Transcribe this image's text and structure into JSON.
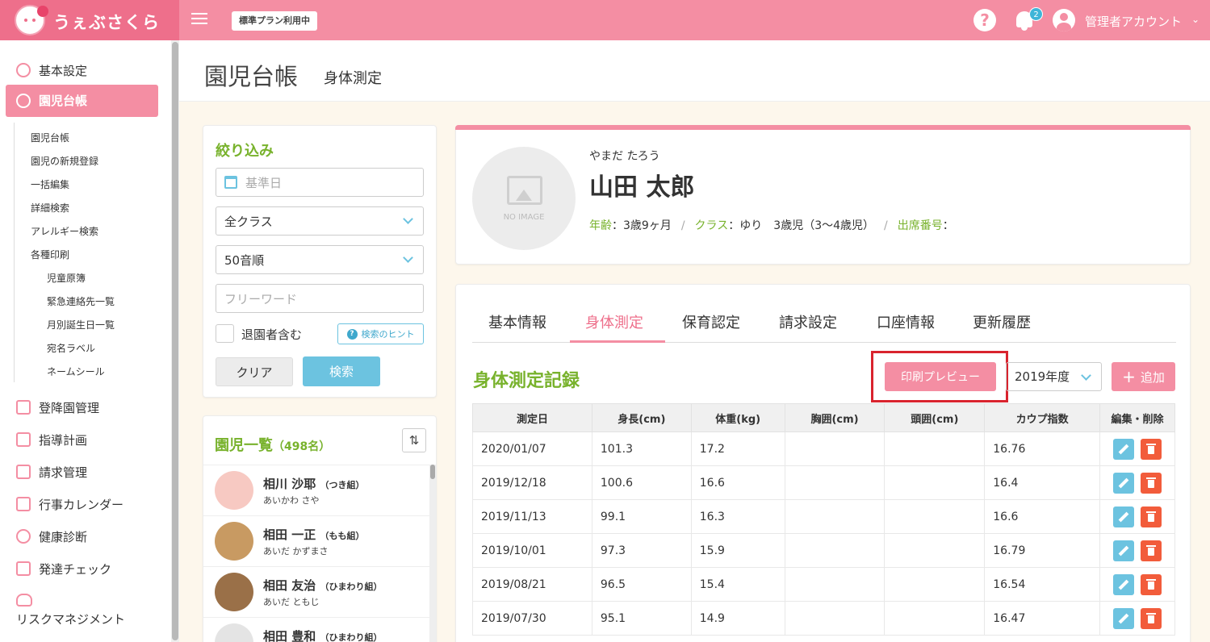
{
  "header": {
    "app_name": "うぇぶさくら",
    "plan_badge": "標準プラン利用中",
    "help_glyph": "?",
    "notification_count": "2",
    "user_name": "管理者アカウント",
    "user_chevron": "⌄"
  },
  "sidebar": {
    "items": [
      {
        "label": "基本設定",
        "icon": "gear-icon"
      },
      {
        "label": "園児台帳",
        "icon": "child-face-icon",
        "active": true
      },
      {
        "label": "登降園管理",
        "icon": "school-icon"
      },
      {
        "label": "指導計画",
        "icon": "notebook-icon"
      },
      {
        "label": "請求管理",
        "icon": "calculator-icon"
      },
      {
        "label": "行事カレンダー",
        "icon": "calendar-icon"
      },
      {
        "label": "健康診断",
        "icon": "stethoscope-icon"
      },
      {
        "label": "発達チェック",
        "icon": "checklist-icon"
      },
      {
        "label": "リスクマネジメント",
        "icon": "hands-heart-icon"
      }
    ],
    "subitems": [
      "園児台帳",
      "園児の新規登録",
      "一括編集",
      "詳細検索",
      "アレルギー検索",
      "各種印刷"
    ],
    "print_subitems": [
      "児童原簿",
      "緊急連絡先一覧",
      "月別誕生日一覧",
      "宛名ラベル",
      "ネームシール"
    ]
  },
  "page": {
    "title": "園児台帳",
    "subtitle": "身体測定"
  },
  "filter": {
    "title": "絞り込み",
    "date_placeholder": "基準日",
    "class_value": "全クラス",
    "order_value": "50音順",
    "keyword_placeholder": "フリーワード",
    "include_withdrawn_label": "退園者含む",
    "hint_label": "検索のヒント",
    "clear_label": "クリア",
    "search_label": "検索"
  },
  "child_list": {
    "title": "園児一覧",
    "count": "（498名）",
    "sort_glyph": "⇅",
    "children": [
      {
        "name": "相川 沙耶",
        "class": "（つき組）",
        "kana": "あいかわ さや"
      },
      {
        "name": "相田 一正",
        "class": "（もも組）",
        "kana": "あいだ かずまさ"
      },
      {
        "name": "相田 友治",
        "class": "（ひまわり組）",
        "kana": "あいだ ともじ"
      },
      {
        "name": "相田 豊和",
        "class": "（ひまわり組）",
        "kana": ""
      }
    ]
  },
  "profile": {
    "no_image_text": "NO IMAGE",
    "kana": "やまだ たろう",
    "name": "山田 太郎",
    "age_label": "年齢",
    "age_value": "：3歳9ヶ月",
    "class_label": "クラス",
    "class_value": "：ゆり　3歳児（3〜4歳児）",
    "seat_label": "出席番号",
    "seat_value": "：",
    "separator": "/"
  },
  "tabs": [
    {
      "label": "基本情報"
    },
    {
      "label": "身体測定",
      "active": true
    },
    {
      "label": "保育認定"
    },
    {
      "label": "請求設定"
    },
    {
      "label": "口座情報"
    },
    {
      "label": "更新履歴"
    }
  ],
  "records": {
    "title": "身体測定記録",
    "print_preview_label": "印刷プレビュー",
    "year_value": "2019年度",
    "add_label": "追加",
    "add_glyph": "+",
    "columns": [
      "測定日",
      "身長(cm)",
      "体重(kg)",
      "胸囲(cm)",
      "頭囲(cm)",
      "カウプ指数",
      "編集・削除"
    ],
    "rows": [
      {
        "date": "2020/01/07",
        "height": "101.3",
        "weight": "17.2",
        "chest": "",
        "head": "",
        "kaup": "16.76"
      },
      {
        "date": "2019/12/18",
        "height": "100.6",
        "weight": "16.6",
        "chest": "",
        "head": "",
        "kaup": "16.4"
      },
      {
        "date": "2019/11/13",
        "height": "99.1",
        "weight": "16.3",
        "chest": "",
        "head": "",
        "kaup": "16.6"
      },
      {
        "date": "2019/10/01",
        "height": "97.3",
        "weight": "15.9",
        "chest": "",
        "head": "",
        "kaup": "16.79"
      },
      {
        "date": "2019/08/21",
        "height": "96.5",
        "weight": "15.4",
        "chest": "",
        "head": "",
        "kaup": "16.54"
      },
      {
        "date": "2019/07/30",
        "height": "95.1",
        "weight": "14.9",
        "chest": "",
        "head": "",
        "kaup": "16.47"
      }
    ]
  },
  "colors": {
    "brand_pink": "#f48ea3",
    "accent_green": "#78b22c",
    "accent_blue": "#6cc3e0",
    "delete_red": "#f25c3b",
    "highlight_red": "#d9232e"
  }
}
